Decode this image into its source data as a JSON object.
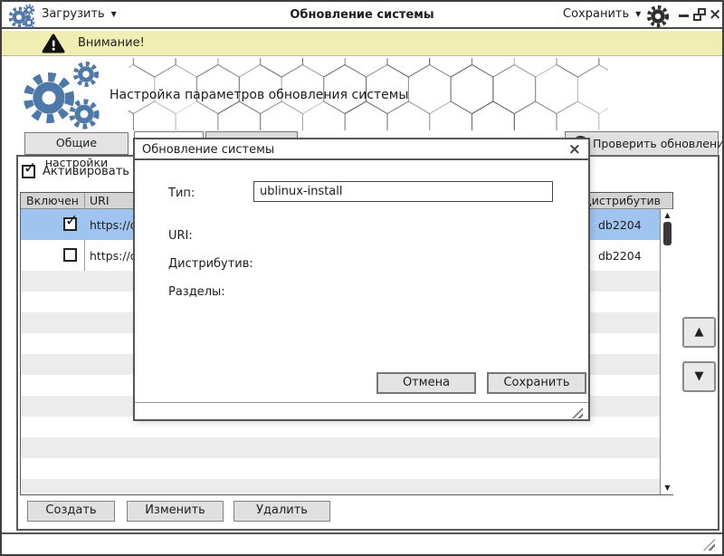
{
  "titlebar": {
    "load_label": "Загрузить",
    "title": "Обновление системы",
    "save_label": "Сохранить"
  },
  "warning_bar": {
    "text": "Внимание!"
  },
  "header": {
    "title": "Настройка параметров обновления системы"
  },
  "tabs": {
    "general": "Общие настройки"
  },
  "toolbar": {
    "check_updates_label": "Проверить обновления"
  },
  "aur_checkbox": {
    "label": "Активировать AUR",
    "checked": true
  },
  "repo_table": {
    "columns": {
      "enabled": "Включен",
      "uri": "URI",
      "distro": "Дистрибутив"
    },
    "rows": [
      {
        "enabled": true,
        "uri": "https://d",
        "distro": "db2204",
        "selected": true
      },
      {
        "enabled": false,
        "uri": "https://d",
        "distro": "db2204",
        "selected": false
      }
    ]
  },
  "actions": {
    "create": "Создать",
    "edit": "Изменить",
    "delete": "Удалить"
  },
  "dialog": {
    "title": "Обновление системы",
    "type_label": "Тип:",
    "type_value": "ublinux-install",
    "uri_label": "URI:",
    "distro_label": "Дистрибутив:",
    "sections_label": "Разделы:",
    "cancel_label": "Отмена",
    "save_label": "Сохранить"
  },
  "icons": {
    "dropdown": "▼",
    "check": "✓",
    "up_arrow": "▲",
    "down_arrow": "▼",
    "close": "×"
  },
  "colors": {
    "accent_blue": "#4e78a8",
    "warning_bg": "#f1eeb4",
    "selected_row": "#9fc4ef"
  }
}
